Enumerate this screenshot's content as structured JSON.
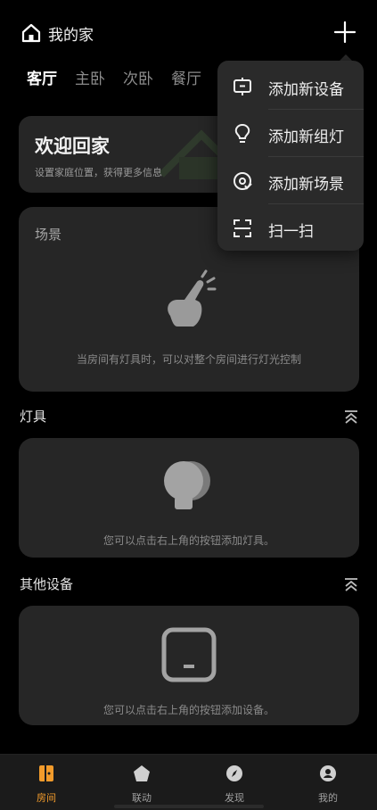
{
  "header": {
    "home_label": "我的家",
    "home_icon": "house-icon",
    "add_icon": "plus-icon"
  },
  "rooms": {
    "tabs": [
      {
        "label": "客厅",
        "active": true
      },
      {
        "label": "主卧",
        "active": false
      },
      {
        "label": "次卧",
        "active": false
      },
      {
        "label": "餐厅",
        "active": false
      }
    ]
  },
  "welcome": {
    "title": "欢迎回家",
    "subtitle": "设置家庭位置，获得更多信息"
  },
  "scenes": {
    "title": "场景",
    "hint": "当房间有灯具时，可以对整个房间进行灯光控制"
  },
  "lights": {
    "title": "灯具",
    "hint": "您可以点击右上角的按钮添加灯具。"
  },
  "devices": {
    "title": "其他设备",
    "hint": "您可以点击右上角的按钮添加设备。"
  },
  "menu": {
    "items": [
      {
        "label": "添加新设备",
        "icon": "device-add-icon"
      },
      {
        "label": "添加新组灯",
        "icon": "bulb-icon"
      },
      {
        "label": "添加新场景",
        "icon": "scene-icon"
      },
      {
        "label": "扫一扫",
        "icon": "scan-icon"
      }
    ]
  },
  "bottom_nav": {
    "items": [
      {
        "label": "房间",
        "icon": "door-icon",
        "active": true
      },
      {
        "label": "联动",
        "icon": "pentagon-icon",
        "active": false
      },
      {
        "label": "发现",
        "icon": "compass-icon",
        "active": false
      },
      {
        "label": "我的",
        "icon": "user-icon",
        "active": false
      }
    ]
  },
  "colors": {
    "background": "#000000",
    "card": "#262626",
    "accent": "#f29b2b",
    "menu": "#2a2a2a"
  }
}
